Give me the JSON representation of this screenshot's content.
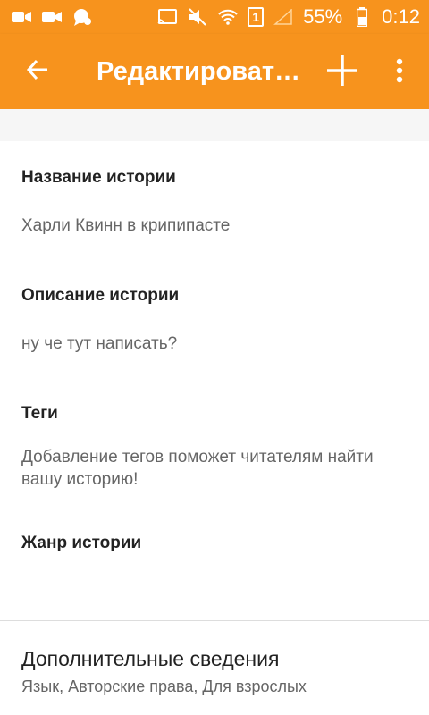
{
  "status_bar": {
    "battery_percent": "55%",
    "time": "0:12",
    "sim_label": "1"
  },
  "app_bar": {
    "title": "Редактироват…",
    "back_icon": "arrow-left-icon",
    "add_icon": "plus-icon",
    "more_icon": "more-vert-icon",
    "color": "#f7931d"
  },
  "form": {
    "story_title_label": "Название истории",
    "story_title_value": "Харли Квинн в крипипасте",
    "description_label": "Описание истории",
    "description_value": "ну че тут написать?",
    "tags_label": "Теги",
    "tags_placeholder": "Добавление тегов поможет читателям найти вашу историю!",
    "genre_label": "Жанр истории"
  },
  "extra": {
    "title": "Дополнительные сведения",
    "subtitle": "Язык, Авторские права, Для взрослых"
  }
}
